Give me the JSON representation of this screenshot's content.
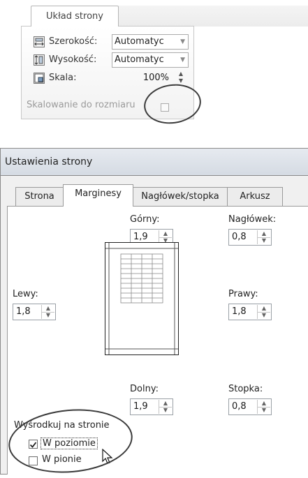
{
  "ribbon": {
    "tab_label": "Układ strony",
    "width_label": "Szerokość:",
    "width_value": "Automatyc",
    "height_label": "Wysokość:",
    "height_value": "Automatyc",
    "scale_label": "Skala:",
    "scale_value": "100%",
    "group_label": "Skalowanie do rozmiaru"
  },
  "dialog": {
    "title": "Ustawienia strony",
    "tabs": [
      "Strona",
      "Marginesy",
      "Nagłówek/stopka",
      "Arkusz"
    ],
    "active_tab": "Marginesy",
    "margins": {
      "top_label": "Górny:",
      "top_value": "1,9",
      "header_label": "Nagłówek:",
      "header_value": "0,8",
      "left_label": "Lewy:",
      "left_value": "1,8",
      "right_label": "Prawy:",
      "right_value": "1,8",
      "bottom_label": "Dolny:",
      "bottom_value": "1,9",
      "footer_label": "Stopka:",
      "footer_value": "0,8"
    },
    "center": {
      "group_label": "Wyśrodkuj na stronie",
      "horizontal_label": "W poziomie",
      "horizontal_checked": true,
      "vertical_label": "W pionie",
      "vertical_checked": false
    }
  }
}
